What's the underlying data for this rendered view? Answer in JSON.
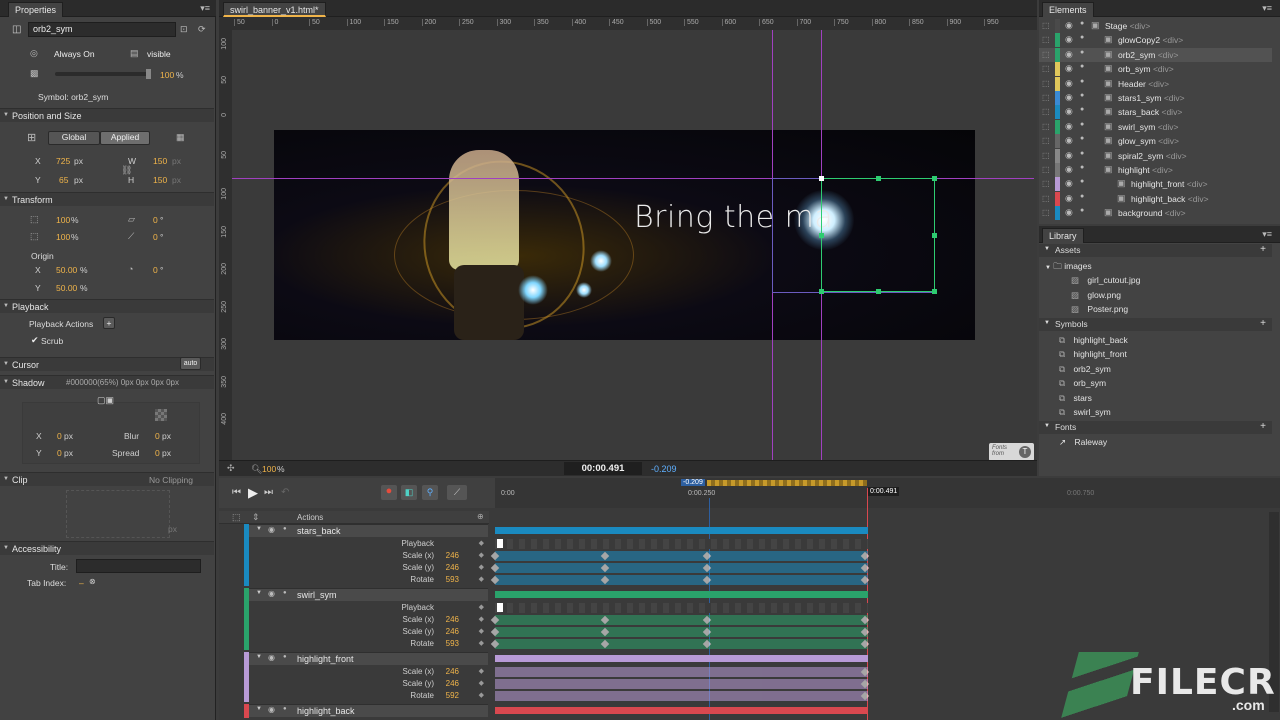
{
  "properties": {
    "tab": "Properties",
    "element_name": "orb2_sym",
    "always_on": "Always On",
    "visible": "visible",
    "opacity": "100",
    "opacity_unit": "%",
    "symbol_label": "Symbol: orb2_sym",
    "pos_size": {
      "title": "Position and Size",
      "global": "Global",
      "applied": "Applied",
      "x": "725",
      "y": "65",
      "w": "150",
      "h": "150",
      "unit": "px"
    },
    "transform": {
      "title": "Transform",
      "scale_x": "100",
      "scale_y": "100",
      "pct": "%",
      "skew_x": "0",
      "skew_y": "0",
      "deg": "°",
      "origin_label": "Origin",
      "origin_x": "50.00",
      "origin_y": "50.00",
      "rotation": "0"
    },
    "playback": {
      "title": "Playback",
      "actions": "Playback Actions",
      "scrub": "Scrub"
    },
    "cursor": {
      "title": "Cursor",
      "auto": "auto"
    },
    "shadow": {
      "title": "Shadow",
      "value": "#000000(65%) 0px 0px 0px 0px",
      "x": "0",
      "y": "0",
      "blur": "0",
      "spread": "0",
      "unit": "px",
      "blur_label": "Blur",
      "spread_label": "Spread"
    },
    "clip": {
      "title": "Clip",
      "value": "No Clipping",
      "unit": "px"
    },
    "accessibility": {
      "title": "Accessibility",
      "title_label": "Title:",
      "tab_index_label": "Tab Index:",
      "tab_index_value": "–"
    }
  },
  "stage": {
    "tab": "swirl_banner_v1.html*",
    "banner_text": "Bring the ma",
    "zoom": "100",
    "zoom_unit": "%",
    "time": "00:00.491",
    "offset": "-0.209",
    "fonts_badge": "Fonts from",
    "ruler_h": [
      "50",
      "0",
      "50",
      "100",
      "150",
      "200",
      "250",
      "300",
      "350",
      "400",
      "450",
      "500",
      "550",
      "600",
      "650",
      "700",
      "750",
      "800",
      "850",
      "900",
      "950"
    ],
    "ruler_v": [
      "100",
      "50",
      "0",
      "50",
      "100",
      "150",
      "200",
      "250",
      "300",
      "350",
      "400"
    ]
  },
  "elements": {
    "tab": "Elements",
    "items": [
      {
        "name": "Stage",
        "tag": "<div>",
        "color": "#4a4a4a"
      },
      {
        "name": "glowCopy2",
        "tag": "<div>",
        "color": "#2aa36b"
      },
      {
        "name": "orb2_sym",
        "tag": "<div>",
        "color": "#2aa36b"
      },
      {
        "name": "orb_sym",
        "tag": "<div>",
        "color": "#e0c75b"
      },
      {
        "name": "Header",
        "tag": "<div>",
        "color": "#e0c75b"
      },
      {
        "name": "stars1_sym",
        "tag": "<div>",
        "color": "#3a8ad4"
      },
      {
        "name": "stars_back",
        "tag": "<div>",
        "color": "#1a8ac0"
      },
      {
        "name": "swirl_sym",
        "tag": "<div>",
        "color": "#2aa36b"
      },
      {
        "name": "glow_sym",
        "tag": "<div>",
        "color": "#666"
      },
      {
        "name": "spiral2_sym",
        "tag": "<div>",
        "color": "#888"
      },
      {
        "name": "highlight",
        "tag": "<div>",
        "color": "#777"
      },
      {
        "name": "highlight_front",
        "tag": "<div>",
        "color": "#b89ad6"
      },
      {
        "name": "highlight_back",
        "tag": "<div>",
        "color": "#d9484f"
      },
      {
        "name": "background",
        "tag": "<div>",
        "color": "#1a8ac0"
      }
    ]
  },
  "library": {
    "tab": "Library",
    "assets": "Assets",
    "images_folder": "images",
    "images": [
      "girl_cutout.jpg",
      "glow.png",
      "Poster.png"
    ],
    "symbols_title": "Symbols",
    "symbols": [
      "highlight_back",
      "highlight_front",
      "orb2_sym",
      "orb_sym",
      "stars",
      "swirl_sym"
    ],
    "fonts_title": "Fonts",
    "fonts": [
      "Raleway"
    ]
  },
  "timeline": {
    "actions": "Actions",
    "time_marks": [
      "0:00",
      "0:00.250",
      "0:00.750"
    ],
    "playhead": "0:00.491",
    "offset_marker": "-0.209",
    "tracks": [
      {
        "name": "stars_back",
        "color": "#1a8ac0",
        "props": [
          {
            "n": "Playback",
            "v": ""
          },
          {
            "n": "Scale (x)",
            "v": "246"
          },
          {
            "n": "Scale (y)",
            "v": "246"
          },
          {
            "n": "Rotate",
            "v": "593"
          }
        ]
      },
      {
        "name": "swirl_sym",
        "color": "#2aa36b",
        "props": [
          {
            "n": "Playback",
            "v": ""
          },
          {
            "n": "Scale (x)",
            "v": "246"
          },
          {
            "n": "Scale (y)",
            "v": "246"
          },
          {
            "n": "Rotate",
            "v": "593"
          }
        ]
      },
      {
        "name": "highlight_front",
        "color": "#b89ad6",
        "props": [
          {
            "n": "Scale (x)",
            "v": "246"
          },
          {
            "n": "Scale (y)",
            "v": "246"
          },
          {
            "n": "Rotate",
            "v": "592"
          }
        ]
      },
      {
        "name": "highlight_back",
        "color": "#d9484f",
        "props": []
      }
    ]
  },
  "watermark": {
    "brand": "FILECR",
    "domain": ".com"
  },
  "colors": {
    "accent": "#f0b44a",
    "select": "#2ecc71",
    "guide": "#a040c0"
  }
}
